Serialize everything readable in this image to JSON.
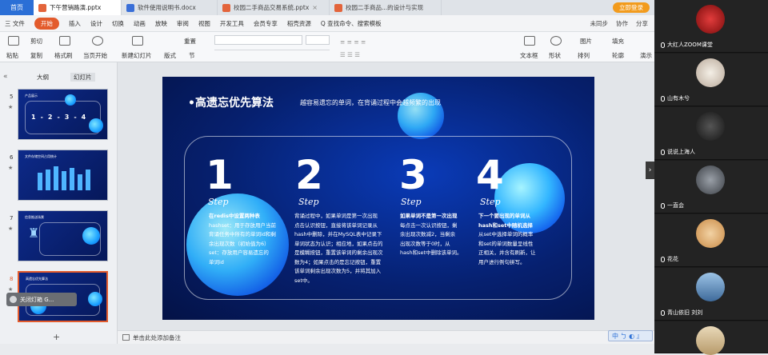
{
  "tabs": {
    "home": "首页",
    "docs": [
      {
        "name": "下午营销路演.pptx",
        "type": "p",
        "active": true
      },
      {
        "name": "软件使用说明书.docx",
        "type": "w",
        "active": false
      },
      {
        "name": "校园二手商品交易系统.pptx",
        "type": "p",
        "active": false
      },
      {
        "name": "校园二手商品...的设计与实现",
        "type": "p",
        "active": false
      }
    ],
    "login": "立即登录"
  },
  "menu": {
    "file": "三 文件",
    "items": [
      "开始",
      "插入",
      "设计",
      "切换",
      "动画",
      "放映",
      "审阅",
      "视图",
      "开发工具",
      "会员专享",
      "稻壳资源"
    ],
    "search": "Q 查找命令、搜索模板",
    "right": [
      "未同步",
      "协作",
      "分享"
    ]
  },
  "ribbon": {
    "paste": "粘贴",
    "cut": "剪切",
    "copy": "复制",
    "format": "格式刷",
    "from_current": "当页开始",
    "new_slide": "新建幻灯片",
    "layout": "版式",
    "section": "节",
    "reset": "重置",
    "text_box": "文本框",
    "shape": "形状",
    "arrange": "排列",
    "picture": "图片",
    "fill": "填充",
    "outline": "轮廓",
    "present": "演示"
  },
  "left_panel": {
    "tab_outline": "大纲",
    "tab_slides": "幻灯片",
    "thumbs": [
      {
        "num": "5",
        "title": "产品展示"
      },
      {
        "num": "6",
        "title": "文件存储空间占用统计"
      },
      {
        "num": "7",
        "title": "信息推送场景"
      },
      {
        "num": "8",
        "title": "高遗忘优先算法"
      }
    ],
    "toast": "关闭灯箱 G..."
  },
  "slide": {
    "title": "•高遗忘优先算法",
    "subtitle": "越容易遗忘的单词，在背诵过程中会越频繁的出现",
    "steps": [
      {
        "num": "1",
        "word": "Step",
        "lines": [
          {
            "t": "在redis中设置两种表",
            "b": true
          },
          {
            "t": "hashset：用于存放用户当前"
          },
          {
            "t": "背诵任务中所有的单词id和剩"
          },
          {
            "t": "余出现次数（初始值为6）"
          },
          {
            "t": "set：存放用户容易遗忘的"
          },
          {
            "t": "单词id"
          }
        ]
      },
      {
        "num": "2",
        "word": "Step",
        "lines": [
          {
            "t": "背诵过程中，如果单词是第一次出现"
          },
          {
            "t": "点击认识按钮，直接将该单词记录从"
          },
          {
            "t": "hash中删除，并在MySQL表中记录下"
          },
          {
            "t": "单词状态为认识；相应地，如果点击的"
          },
          {
            "t": "是模糊按钮，重置该单词的剩余出现次"
          },
          {
            "t": "数为4；如果点击的是忘记按钮，重置"
          },
          {
            "t": "该单词剩余出现次数为5，并将其加入"
          },
          {
            "t": "set中。"
          }
        ]
      },
      {
        "num": "3",
        "word": "Step",
        "lines": [
          {
            "t": "如果单词不是第一次出现"
          },
          {
            "t": "每点击一次认识按钮，剩"
          },
          {
            "t": "余出现次数减2，当剩余"
          },
          {
            "t": "出现次数等于0时，从"
          },
          {
            "t": "hash和set中删除该单词。"
          }
        ]
      },
      {
        "num": "4",
        "word": "Step",
        "lines": [
          {
            "t": "下一个要出现的单词从",
            "b": true
          },
          {
            "t": "hash和set中随机选择",
            "b": true
          },
          {
            "t": "从set中选择单词的概率"
          },
          {
            "t": "和set的单词数量呈线性"
          },
          {
            "t": "正相关，并含有刷新，让"
          },
          {
            "t": "用户进行例句拼写。"
          }
        ]
      }
    ]
  },
  "status": {
    "notes": "单击此处添加备注",
    "ime": "中 ㄅ ◐ 』"
  },
  "participants": [
    {
      "name": "大红人ZOOM课堂"
    },
    {
      "name": "山有木兮"
    },
    {
      "name": "说说上海人"
    },
    {
      "name": "一直会"
    },
    {
      "name": "花花"
    },
    {
      "name": "青山依旧 刘刘"
    },
    {
      "name": ""
    }
  ],
  "colors": {
    "accent": "#e35b2c",
    "brand": "#2b6fd6",
    "slide_bg": "#06206f"
  }
}
